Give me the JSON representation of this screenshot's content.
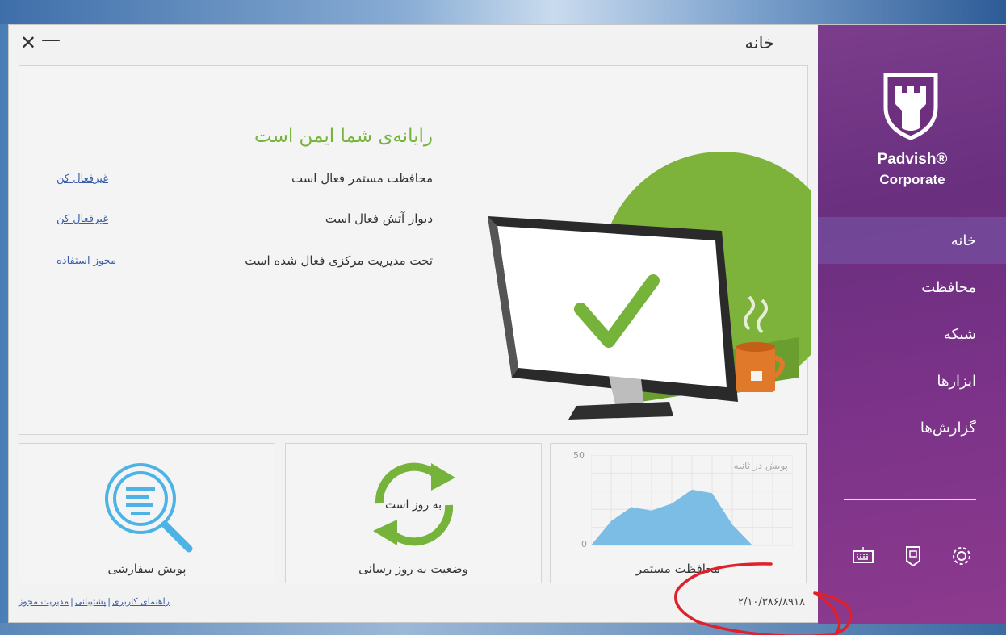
{
  "window": {
    "title": "خانه",
    "close_glyph": "✕",
    "minimize_glyph": "—"
  },
  "sidebar": {
    "brand": "Padvish®",
    "edition": "Corporate",
    "items": [
      {
        "label": "خانه",
        "active": true
      },
      {
        "label": "محافظت",
        "active": false
      },
      {
        "label": "شبکه",
        "active": false
      },
      {
        "label": "ابزارها",
        "active": false
      },
      {
        "label": "گزارش‌ها",
        "active": false
      }
    ],
    "bottom_icons": [
      "virtual-keyboard-icon",
      "usb-drive-icon",
      "settings-gear-icon"
    ]
  },
  "status": {
    "headline": "رایانه‌ی شما ایمن است",
    "rows": [
      {
        "text": "محافظت مستمر فعال است",
        "link": "غیرفعال کن"
      },
      {
        "text": "دیوار آتش فعال است",
        "link": "غیرفعال کن"
      },
      {
        "text": "تحت مدیریت مرکزی فعال شده است",
        "link": "مجوز استفاده"
      }
    ]
  },
  "tiles": {
    "custom_scan": {
      "label": "پویش سفارشی",
      "icon": "magnifier-icon"
    },
    "update": {
      "label": "وضعیت به روز رسانی",
      "status_text": "به روز است",
      "icon": "refresh-arrows-icon"
    },
    "realtime": {
      "label": "محافظت مستمر",
      "chart_caption": "پویش در ثانیه"
    }
  },
  "chart_data": {
    "type": "area",
    "title": "پویش در ثانیه",
    "ylim": [
      0,
      50
    ],
    "y_ticks": [
      "50",
      "0"
    ],
    "x": [
      0,
      1,
      2,
      3,
      4,
      5,
      6,
      7,
      8,
      9,
      10
    ],
    "values": [
      0,
      14,
      22,
      20,
      24,
      32,
      30,
      12,
      0,
      0,
      0
    ],
    "color": "#7bbde4",
    "grid": true
  },
  "footer": {
    "links": [
      "راهنمای کاربری",
      "پشتیبانی",
      "مدیریت مجوز"
    ],
    "separator": "|",
    "version": "۲/۱۰/۳۸۶/۸۹۱۸"
  },
  "colors": {
    "accent_green": "#76b33b",
    "sidebar_purple": "#6f3282",
    "link_blue": "#3c5ea8",
    "annotation_red": "#e0202a"
  }
}
